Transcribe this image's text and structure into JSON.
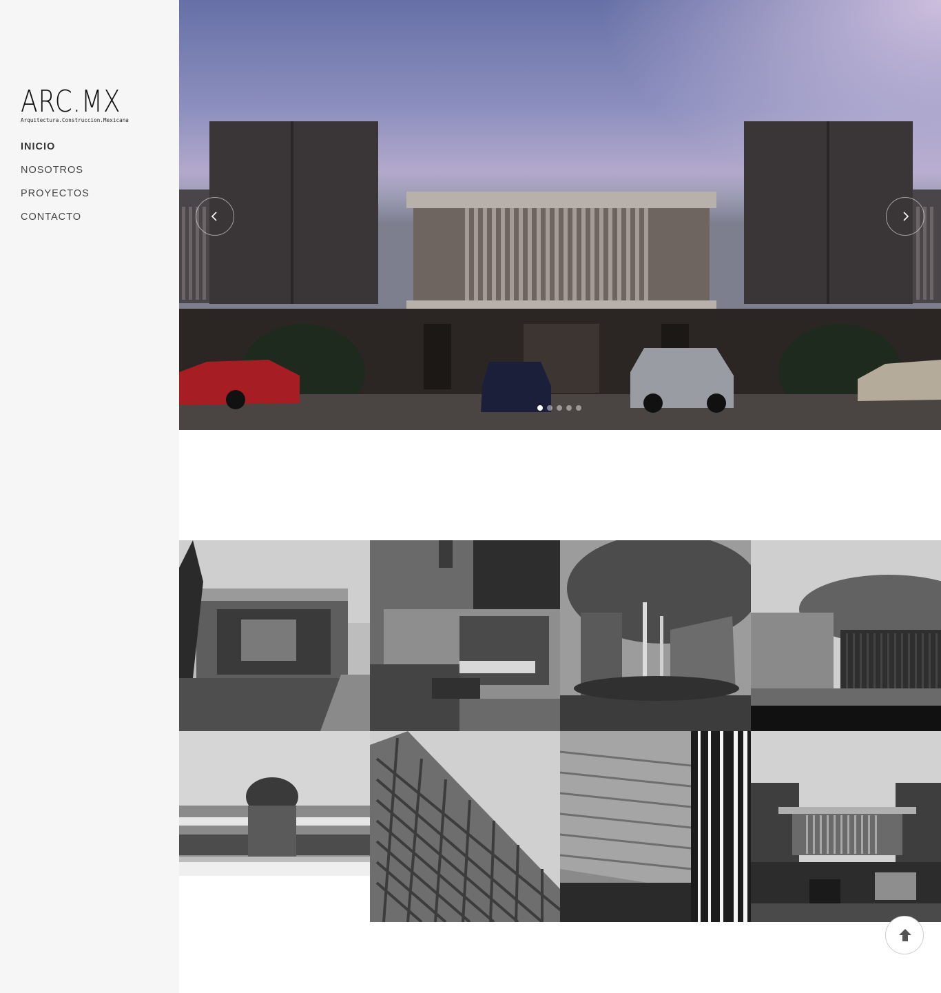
{
  "brand": {
    "logo_main": "ARC.MX",
    "logo_sub": "Arquitectura.Construccion.Mexicana"
  },
  "nav": {
    "items": [
      {
        "label": "INICIO",
        "active": true
      },
      {
        "label": "NOSOTROS",
        "active": false
      },
      {
        "label": "PROYECTOS",
        "active": false
      },
      {
        "label": "CONTACTO",
        "active": false
      }
    ]
  },
  "slider": {
    "slide_count": 5,
    "active_index": 0,
    "prev_icon": "chevron-left-icon",
    "next_icon": "chevron-right-icon"
  },
  "gallery": {
    "tile_count": 8
  },
  "scroll_top_icon": "arrow-up-icon",
  "colors": {
    "sidebar_bg": "#f6f6f6",
    "text": "#444444"
  }
}
